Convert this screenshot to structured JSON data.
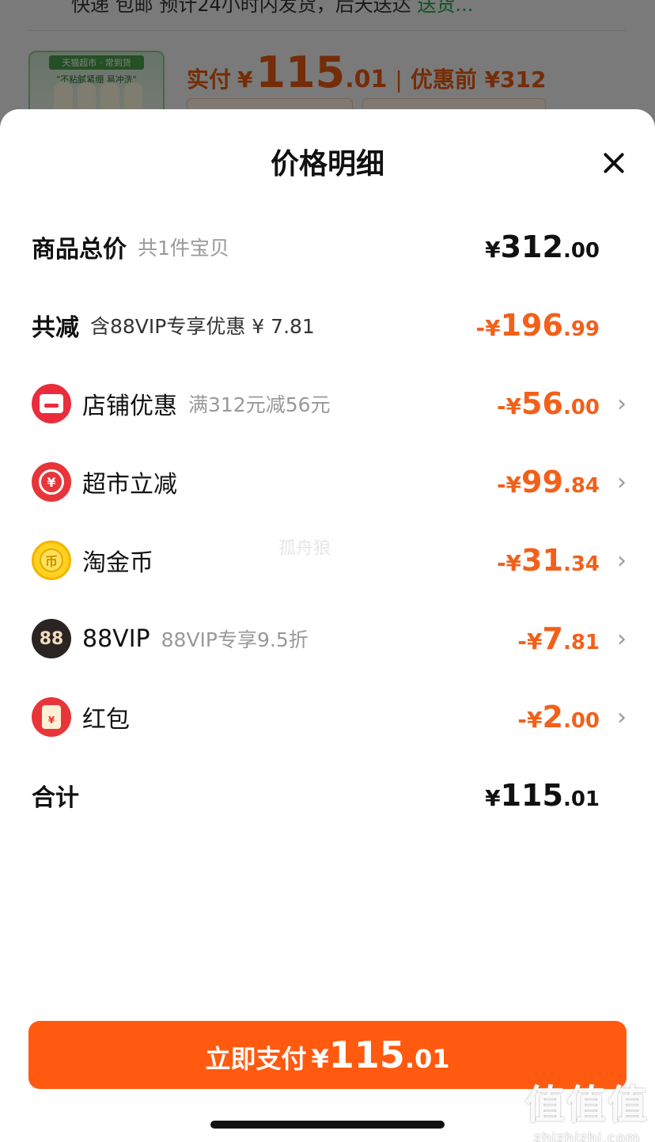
{
  "background": {
    "shipping_text": "快递 包邮 预计24小时内发货，后天送达",
    "shipping_link": "送货...",
    "thumb_line1": "天猫超市 · 常到货",
    "thumb_line2": "\"不粘腻紧绷 易冲洗\"",
    "paid_label": "实付",
    "paid_currency": "¥",
    "paid_int": "115",
    "paid_dec": ".01",
    "separator": "|",
    "before_discount": "优惠前 ¥312"
  },
  "sheet": {
    "title": "价格明细",
    "close_icon": "close-icon"
  },
  "rows": {
    "subtotal": {
      "label": "商品总价",
      "sub": "共1件宝贝",
      "pre": "¥",
      "int": "312",
      "dec": ".00"
    },
    "total_discount": {
      "label": "共减",
      "sub": "含88VIP专享优惠 ¥ 7.81",
      "pre": "-¥",
      "int": "196",
      "dec": ".99"
    },
    "shop": {
      "icon": "shop-icon",
      "label": "店铺优惠",
      "sub": "满312元减56元",
      "pre": "-¥",
      "int": "56",
      "dec": ".00"
    },
    "market": {
      "icon": "supermarket-discount-icon",
      "glyph": "¥",
      "label": "超市立减",
      "pre": "-¥",
      "int": "99",
      "dec": ".84"
    },
    "coin": {
      "icon": "gold-coin-icon",
      "glyph": "币",
      "label": "淘金币",
      "pre": "-¥",
      "int": "31",
      "dec": ".34"
    },
    "vip": {
      "icon": "88vip-icon",
      "glyph": "88",
      "label": "88VIP",
      "sub": "88VIP专享9.5折",
      "pre": "-¥",
      "int": "7",
      "dec": ".81"
    },
    "redpack": {
      "icon": "red-packet-icon",
      "glyph": "¥",
      "label": "红包",
      "pre": "-¥",
      "int": "2",
      "dec": ".00"
    },
    "total": {
      "label": "合计",
      "pre": "¥",
      "int": "115",
      "dec": ".01"
    }
  },
  "chevron": "›",
  "watermark": "孤舟狼",
  "pay_button": {
    "label": "立即支付",
    "pre": "¥",
    "int": "115",
    "dec": ".01"
  },
  "site_logo": {
    "zh": "值值值",
    "en": "zhizhizhi.com"
  },
  "colors": {
    "accent": "#ff5a0f",
    "discount": "#f2601a"
  }
}
